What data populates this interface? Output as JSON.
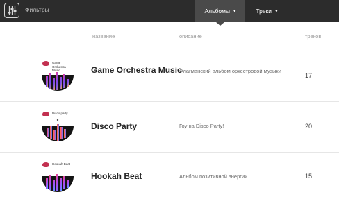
{
  "topbar": {
    "filter_label": "Фильтры",
    "tabs": [
      {
        "label": "Альбомы",
        "active": true
      },
      {
        "label": "Треки",
        "active": false
      }
    ]
  },
  "columns": {
    "name": "название",
    "description": "описание",
    "tracks": "треков"
  },
  "albums": [
    {
      "cover_title": "Game Orchestra Music",
      "title": "Game Orchestra Music",
      "description": "Флагманский альбом оркестровой музыки",
      "tracks": "17"
    },
    {
      "cover_title": "Disco party",
      "title": "Disco Party",
      "description": "Гоу на Disco Party!",
      "tracks": "20"
    },
    {
      "cover_title": "Hookah Beat",
      "title": "Hookah Beat",
      "description": "Альбом позитивной энергии",
      "tracks": "15"
    }
  ],
  "colors": {
    "topbar": "#2c2c2c",
    "active_tab": "#4a4a4a",
    "cover_gradient": [
      "#e84a9a",
      "#5a5aff",
      "#ffb23a"
    ]
  },
  "icons": [
    "filter-icon",
    "chevron-down-icon",
    "album-cover-image"
  ]
}
